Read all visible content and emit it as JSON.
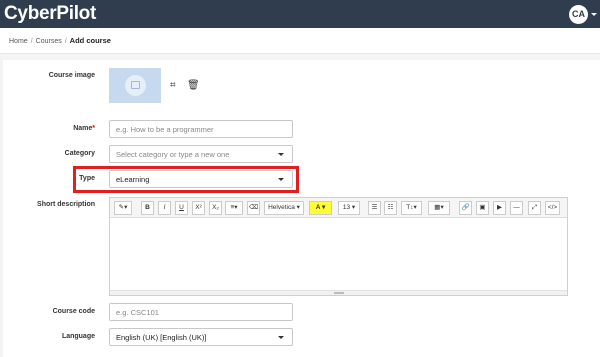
{
  "header": {
    "logo": "CyberPilot",
    "avatar_initials": "CA"
  },
  "breadcrumb": {
    "items": [
      "Home",
      "Courses"
    ],
    "current": "Add course"
  },
  "form": {
    "course_image": {
      "label": "Course image",
      "crop_icon": "crop-icon",
      "delete_icon": "trash-icon"
    },
    "name": {
      "label": "Name",
      "required_mark": "*",
      "placeholder": "e.g. How to be a programmer",
      "value": ""
    },
    "category": {
      "label": "Category",
      "placeholder": "Select category or type a new one"
    },
    "type": {
      "label": "Type",
      "value": "eLearning"
    },
    "short_description": {
      "label": "Short description",
      "toolbar": {
        "magic": "✎▾",
        "bold": "B",
        "italic": "I",
        "underline": "U",
        "superscript": "X²",
        "subscript": "X₂",
        "align": "≡▾",
        "clear_format": "⌫",
        "font_family": "Helvetica ▾",
        "highlight": "A ▾",
        "font_size": "13 ▾",
        "unordered_list": "☰",
        "ordered_list": "☷",
        "text_style": "T↕▾",
        "table": "▦▾",
        "link": "🔗",
        "image": "▣",
        "video": "▶",
        "hr": "—",
        "fullscreen": "⤢",
        "code": "</>"
      }
    },
    "course_code": {
      "label": "Course code",
      "placeholder": "e.g. CSC101"
    },
    "language": {
      "label": "Language",
      "value": "English (UK) [English (UK)]"
    }
  },
  "colors": {
    "header_bg": "#2f3d4f",
    "highlight_border": "#e02020",
    "image_placeholder_bg": "#c7d9ee"
  }
}
